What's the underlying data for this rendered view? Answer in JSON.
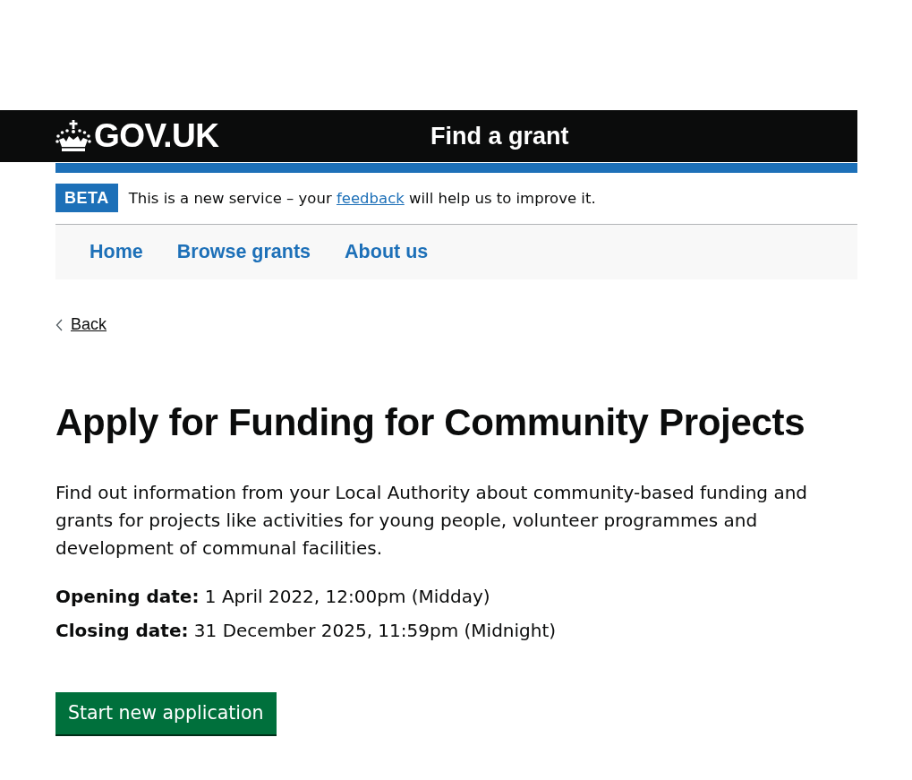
{
  "header": {
    "logo_text": "GOV.UK",
    "service_name": "Find a grant"
  },
  "phase_banner": {
    "tag": "BETA",
    "message_start": "This is a new service – your",
    "link": "feedback",
    "message_end": "will help us to improve it."
  },
  "navigation": [
    {
      "label": "Home"
    },
    {
      "label": "Browse grants"
    },
    {
      "label": "About us"
    }
  ],
  "back_link": "Back",
  "title": "Apply for Funding for Community Projects",
  "description": "Find out information from your Local Authority about community-based funding and grants for projects like activities for young people, volunteer programmes and development of communal facilities.",
  "dates": [
    {
      "text": "**Opening date:** 1 April 2022, 12:00pm (Midday)"
    },
    {
      "text": "**Closing date:** 31 December 2025, 11:59pm (Midnight)"
    }
  ],
  "start_button": "Start new application"
}
